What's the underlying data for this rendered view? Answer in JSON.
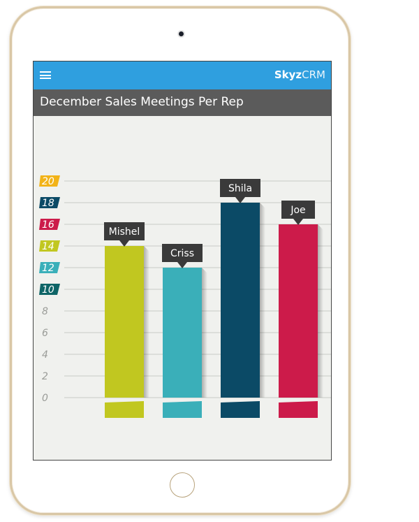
{
  "app": {
    "brand_bold": "Skyz",
    "brand_light": "CRM"
  },
  "header": {
    "title": "December Sales Meetings Per Rep"
  },
  "chart_data": {
    "type": "bar",
    "title": "December Sales Meetings Per Rep",
    "categories": [
      "Mishel",
      "Criss",
      "Shila",
      "Joe"
    ],
    "values": [
      14,
      12,
      18,
      16
    ],
    "bar_colors": [
      "#c1c720",
      "#3aafb9",
      "#0b4a66",
      "#cc1b4a"
    ],
    "ylim": [
      0,
      20
    ],
    "yticks": [
      0,
      2,
      4,
      6,
      8,
      10,
      12,
      14,
      16,
      18,
      20
    ],
    "ytick_badge_colors": {
      "10": "#0e6466",
      "12": "#3aafb9",
      "14": "#c1c720",
      "16": "#cc1b4a",
      "18": "#0b4a66",
      "20": "#f2b318"
    },
    "grid": true,
    "legend": "none",
    "xlabel": "",
    "ylabel": ""
  }
}
